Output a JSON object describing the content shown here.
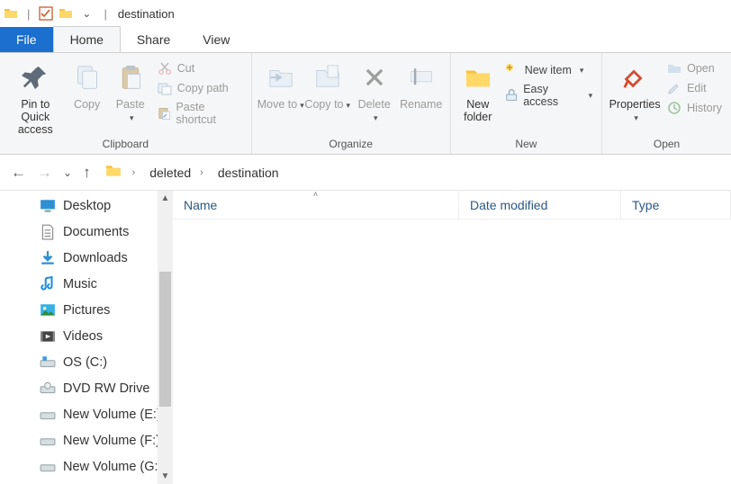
{
  "window": {
    "title": "destination"
  },
  "tabs": {
    "file": "File",
    "home": "Home",
    "share": "Share",
    "view": "View"
  },
  "ribbon": {
    "clipboard": {
      "label": "Clipboard",
      "pin": "Pin to Quick access",
      "copy": "Copy",
      "paste": "Paste",
      "cut": "Cut",
      "copy_path": "Copy path",
      "paste_shortcut": "Paste shortcut"
    },
    "organize": {
      "label": "Organize",
      "move_to": "Move to",
      "copy_to": "Copy to",
      "delete": "Delete",
      "rename": "Rename"
    },
    "new": {
      "label": "New",
      "new_folder": "New folder",
      "new_item": "New item",
      "easy_access": "Easy access"
    },
    "open": {
      "label": "Open",
      "properties": "Properties",
      "open": "Open",
      "edit": "Edit",
      "history": "History"
    }
  },
  "breadcrumbs": {
    "level1": "deleted",
    "level2": "destination"
  },
  "nav_items": [
    "Desktop",
    "Documents",
    "Downloads",
    "Music",
    "Pictures",
    "Videos",
    "OS (C:)",
    "DVD RW Drive",
    "New Volume (E:)",
    "New Volume (F:)",
    "New Volume (G:)"
  ],
  "columns": {
    "name": "Name",
    "modified": "Date modified",
    "type": "Type"
  }
}
